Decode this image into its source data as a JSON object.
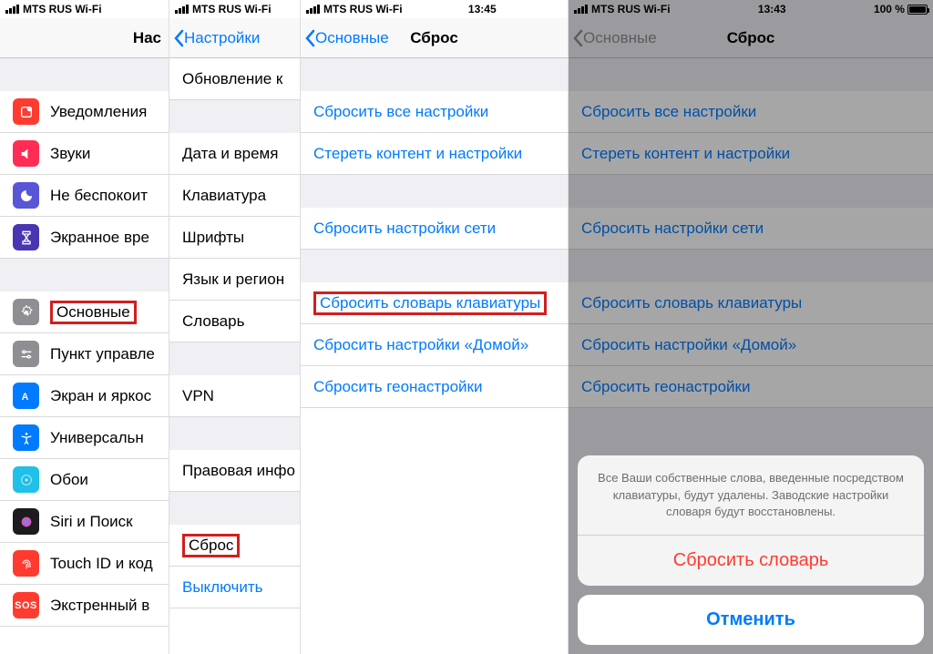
{
  "status": {
    "carrier": "MTS RUS",
    "conn": "Wi-Fi",
    "carrier_full": "MTS RUS Wi-Fi",
    "time3": "13:45",
    "time4": "13:43",
    "battery4": "100 %"
  },
  "col1": {
    "title": "Нас",
    "items": {
      "notifications": "Уведомления",
      "sounds": "Звуки",
      "dnd": "Не беспокоит",
      "screentime": "Экранное вре",
      "general": "Основные",
      "control": "Пункт управле",
      "display": "Экран и яркос",
      "accessibility": "Универсальн",
      "wallpaper": "Обои",
      "siri": "Siri и Поиск",
      "touchid": "Touch ID и код",
      "sos": "Экстренный в"
    }
  },
  "col2": {
    "back": "Настройки",
    "items": {
      "update": "Обновление к",
      "datetime": "Дата и время",
      "keyboard": "Клавиатура",
      "fonts": "Шрифты",
      "lang": "Язык и регион",
      "dict": "Словарь",
      "vpn": "VPN",
      "legal": "Правовая инфо",
      "reset": "Сброс",
      "shutdown": "Выключить"
    }
  },
  "col3": {
    "back": "Основные",
    "title": "Сброс",
    "items": {
      "all": "Сбросить все настройки",
      "erase": "Стереть контент и настройки",
      "net": "Сбросить настройки сети",
      "kbd": "Сбросить словарь клавиатуры",
      "home": "Сбросить настройки «Домой»",
      "geo": "Сбросить геонастройки"
    }
  },
  "col4": {
    "back": "Основные",
    "title": "Сброс",
    "items": {
      "all": "Сбросить все настройки",
      "erase": "Стереть контент и настройки",
      "net": "Сбросить настройки сети",
      "kbd": "Сбросить словарь клавиатуры",
      "home": "Сбросить настройки «Домой»",
      "geo": "Сбросить геонастройки"
    },
    "sheet": {
      "message": "Все Ваши собственные слова, введенные посредством клавиатуры, будут удалены. Заводские настройки словаря будут восстановлены.",
      "action": "Сбросить словарь",
      "cancel": "Отменить"
    }
  }
}
